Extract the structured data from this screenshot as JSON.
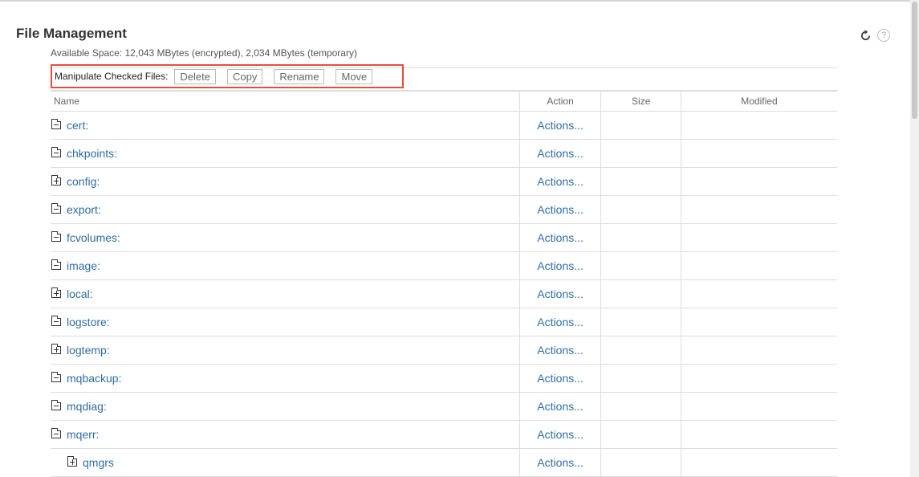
{
  "page": {
    "title": "File Management",
    "space_info": "Available Space: 12,043 MBytes (encrypted), 2,034 MBytes (temporary)"
  },
  "toolbar": {
    "label": "Manipulate Checked Files:",
    "delete": "Delete",
    "copy": "Copy",
    "rename": "Rename",
    "move": "Move"
  },
  "header_icons": {
    "refresh": "refresh-icon",
    "help": "?"
  },
  "table": {
    "columns": [
      "Name",
      "Action",
      "Size",
      "Modified"
    ],
    "rows": [
      {
        "name": "cert:",
        "state": "collapsed-minus",
        "indent": 0,
        "action": "Actions..."
      },
      {
        "name": "chkpoints:",
        "state": "minus",
        "indent": 0,
        "action": "Actions..."
      },
      {
        "name": "config:",
        "state": "plus",
        "indent": 0,
        "action": "Actions..."
      },
      {
        "name": "export:",
        "state": "minus",
        "indent": 0,
        "action": "Actions..."
      },
      {
        "name": "fcvolumes:",
        "state": "minus",
        "indent": 0,
        "action": "Actions..."
      },
      {
        "name": "image:",
        "state": "minus",
        "indent": 0,
        "action": "Actions..."
      },
      {
        "name": "local:",
        "state": "plus",
        "indent": 0,
        "action": "Actions..."
      },
      {
        "name": "logstore:",
        "state": "minus",
        "indent": 0,
        "action": "Actions..."
      },
      {
        "name": "logtemp:",
        "state": "plus",
        "indent": 0,
        "action": "Actions..."
      },
      {
        "name": "mqbackup:",
        "state": "minus",
        "indent": 0,
        "action": "Actions..."
      },
      {
        "name": "mqdiag:",
        "state": "minus",
        "indent": 0,
        "action": "Actions..."
      },
      {
        "name": "mqerr:",
        "state": "minus",
        "indent": 0,
        "action": "Actions..."
      },
      {
        "name": "qmgrs",
        "state": "plus",
        "indent": 1,
        "action": "Actions..."
      }
    ]
  }
}
